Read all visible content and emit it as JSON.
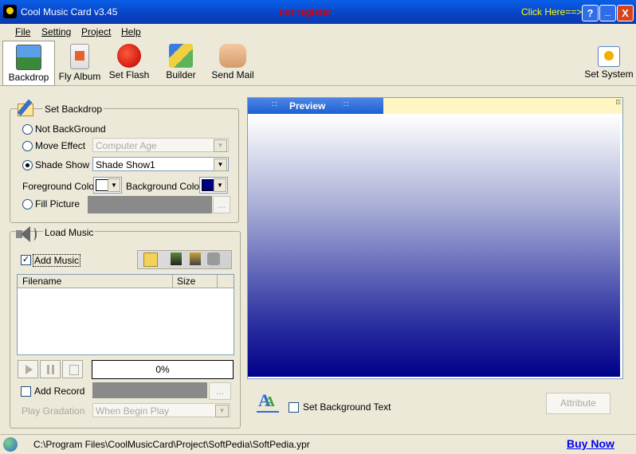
{
  "window": {
    "title": "Cool Music Card v3.45",
    "register_status": "not register",
    "click_here": "Click Here==>>>",
    "help_btn": "?",
    "min_btn": "_",
    "close_btn": "X"
  },
  "menu": [
    {
      "label": "File"
    },
    {
      "label": "Setting"
    },
    {
      "label": "Project"
    },
    {
      "label": "Help"
    }
  ],
  "toolbar": {
    "items": [
      {
        "label": "Backdrop",
        "icon": "landscape-icon"
      },
      {
        "label": "Fly Album",
        "icon": "album-icon"
      },
      {
        "label": "Set Flash",
        "icon": "flash-icon"
      },
      {
        "label": "Builder",
        "icon": "builder-icon"
      },
      {
        "label": "Send Mail",
        "icon": "handshake-icon"
      }
    ],
    "set_system": "Set System"
  },
  "backdrop": {
    "title": "Set Backdrop",
    "not_background": "Not BackGround",
    "move_effect": "Move Effect",
    "move_effect_value": "Computer Age",
    "shade_show": "Shade Show",
    "shade_show_value": "Shade Show1",
    "foreground_color_label": "Foreground Color",
    "background_color_label": "Background Color",
    "foreground_color": "#ffffff",
    "background_color": "#000080",
    "fill_picture": "Fill Picture",
    "browse": "..."
  },
  "music": {
    "title": "Load Music",
    "add_music": "Add Music",
    "add_music_checked": true,
    "columns": {
      "filename": "Filename",
      "size": "Size"
    },
    "files": [],
    "progress": "0%",
    "add_record": "Add Record",
    "browse": "...",
    "play_gradation_label": "Play Gradation",
    "play_gradation_value": "When Begin Play"
  },
  "preview": {
    "title": "Preview",
    "set_bg_text": "Set Background Text",
    "attribute": "Attribute",
    "gradient_top": "#ffffff",
    "gradient_bottom": "#00008a"
  },
  "status": {
    "path": "C:\\Program Files\\CoolMusicCard\\Project\\SoftPedia\\SoftPedia.ypr",
    "buy_now": "Buy Now"
  }
}
